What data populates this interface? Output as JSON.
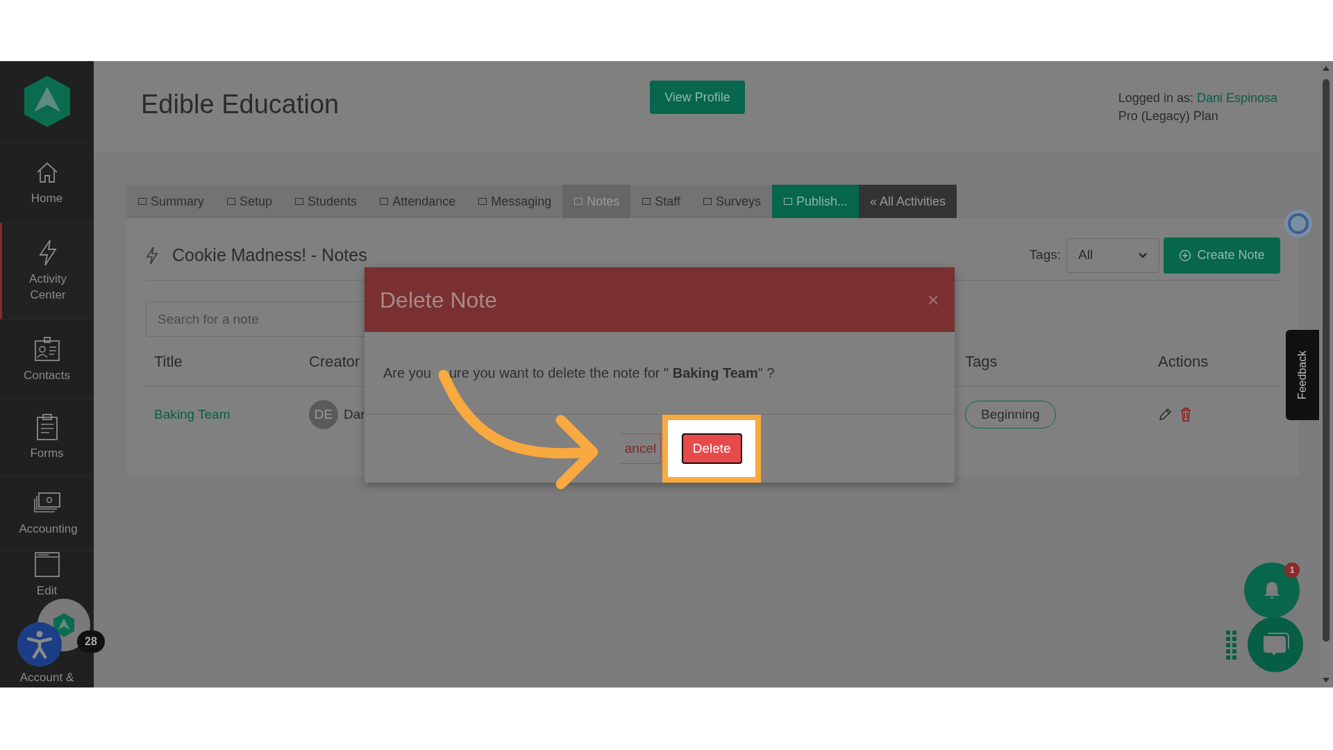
{
  "sidebar": {
    "items": [
      {
        "label": "Home",
        "selected": false
      },
      {
        "label": "Activity Center",
        "selected": true
      },
      {
        "label": "Contacts",
        "selected": false
      },
      {
        "label": "Forms",
        "selected": false
      },
      {
        "label": "Accounting",
        "selected": false
      },
      {
        "label": "Edit",
        "selected": false
      },
      {
        "label": "Account &",
        "selected": false
      }
    ]
  },
  "widget_badge": "28",
  "header": {
    "title": "Edible Education",
    "profile_button": "View Profile",
    "logged_in_label": "Logged in as:",
    "user": "Dani Espinosa",
    "plan": "Pro (Legacy) Plan"
  },
  "tabs": [
    {
      "label": "Summary",
      "kind": "normal",
      "selected": false
    },
    {
      "label": "Setup",
      "kind": "normal",
      "selected": false
    },
    {
      "label": "Students",
      "kind": "normal",
      "selected": false
    },
    {
      "label": "Attendance",
      "kind": "normal",
      "selected": false
    },
    {
      "label": "Messaging",
      "kind": "normal",
      "selected": false
    },
    {
      "label": "Notes",
      "kind": "normal",
      "selected": true
    },
    {
      "label": "Staff",
      "kind": "normal",
      "selected": false
    },
    {
      "label": "Surveys",
      "kind": "normal",
      "selected": false
    },
    {
      "label": "Publish...",
      "kind": "publish",
      "selected": false
    },
    {
      "label": "« All Activities",
      "kind": "back",
      "selected": false
    }
  ],
  "notes": {
    "heading": "Cookie Madness! - Notes",
    "tags_label": "Tags:",
    "tags_value": "All",
    "create_button": "Create Note",
    "search_placeholder": "Search for a note",
    "columns": [
      "Title",
      "Creator",
      "Tags",
      "Actions"
    ],
    "rows": [
      {
        "title": "Baking Team",
        "initials": "DE",
        "creator": "Dar",
        "tag": "Beginning"
      }
    ]
  },
  "feedback": "Feedback",
  "dialog": {
    "title": "Delete Note",
    "close": "×",
    "message_start": "Are you",
    "message_end": "ure you want to delete the note for \" **Baking Team**\" ?",
    "buttons": [
      {
        "label": "ancel",
        "kind": "cancel",
        "highlighted": false
      },
      {
        "label": "Delete",
        "kind": "danger",
        "highlighted": true
      }
    ]
  },
  "notification_badge": "1"
}
